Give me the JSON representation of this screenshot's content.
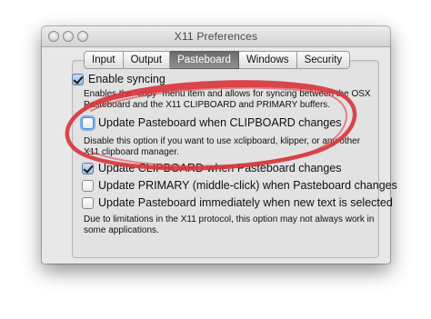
{
  "window": {
    "title": "X11 Preferences"
  },
  "tabs": [
    {
      "label": "Input",
      "active": false
    },
    {
      "label": "Output",
      "active": false
    },
    {
      "label": "Pasteboard",
      "active": true
    },
    {
      "label": "Windows",
      "active": false
    },
    {
      "label": "Security",
      "active": false
    }
  ],
  "options": {
    "enable_syncing": {
      "label": "Enable syncing",
      "checked": true,
      "description": "Enables the \"copy\" menu item and allows for syncing between the OSX Pasteboard and the X11 CLIPBOARD and PRIMARY buffers."
    },
    "update_pasteboard_clipboard": {
      "label": "Update Pasteboard when CLIPBOARD changes",
      "checked": false,
      "description": "Disable this option if you want to use xclipboard, klipper, or any other X11 clipboard manager."
    },
    "update_clipboard_pasteboard": {
      "label": "Update CLIPBOARD when Pasteboard changes",
      "checked": true
    },
    "update_primary_pasteboard": {
      "label": "Update PRIMARY (middle-click) when Pasteboard changes",
      "checked": false
    },
    "update_pasteboard_immediately": {
      "label": "Update Pasteboard immediately when new text is selected",
      "checked": false,
      "description": "Due to limitations in the X11 protocol, this option may not always work in some applications."
    }
  },
  "annotation": {
    "color": "#d9343a",
    "shape": "hand-drawn ellipse"
  }
}
